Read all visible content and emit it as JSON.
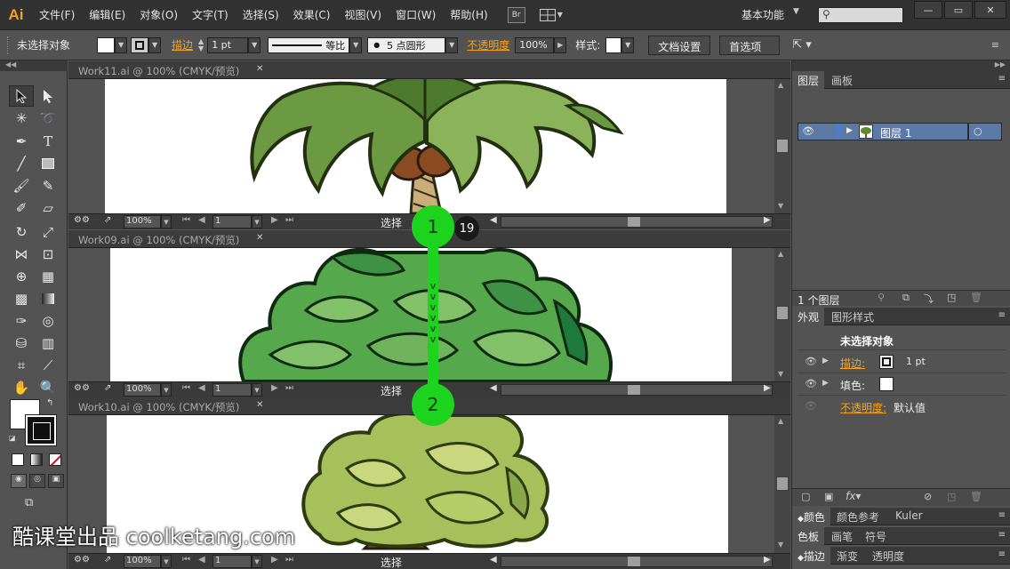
{
  "app": {
    "logo": "Ai"
  },
  "menu": [
    "文件(F)",
    "编辑(E)",
    "对象(O)",
    "文字(T)",
    "选择(S)",
    "效果(C)",
    "视图(V)",
    "窗口(W)",
    "帮助(H)"
  ],
  "menu_extras": {
    "bridge": "Br",
    "workspace": "基本功能"
  },
  "window_buttons": {
    "minimize": "—",
    "restore": "▭",
    "close": "✕"
  },
  "control": {
    "selection": "未选择对象",
    "stroke_label": "描边",
    "stroke_weight": "1 pt",
    "profile": "等比",
    "brush": "5 点圆形",
    "opacity_label": "不透明度",
    "opacity_value": "100%",
    "style_label": "样式:",
    "doc_setup": "文档设置",
    "preferences": "首选项"
  },
  "documents": [
    {
      "title": "Work11.ai @ 100% (CMYK/预览)",
      "zoom": "100%",
      "page": "1",
      "mode": "选择"
    },
    {
      "title": "Work09.ai @ 100% (CMYK/预览)",
      "zoom": "100%",
      "page": "1",
      "mode": "选择"
    },
    {
      "title": "Work10.ai @ 100% (CMYK/预览)",
      "zoom": "100%",
      "page": "1",
      "mode": "选择"
    }
  ],
  "layers_panel": {
    "tabs": [
      "图层",
      "画板"
    ],
    "layer_name": "图层 1",
    "footer": "1 个图层"
  },
  "appearance_panel": {
    "tabs": [
      "外观",
      "图形样式"
    ],
    "heading": "未选择对象",
    "stroke_label": "描边:",
    "stroke_value": "1 pt",
    "fill_label": "填色:",
    "opacity_label": "不透明度:",
    "opacity_value": "默认值"
  },
  "bottom_tabs": {
    "row1": [
      "颜色",
      "颜色参考",
      "Kuler"
    ],
    "row2": [
      "色板",
      "画笔",
      "符号"
    ],
    "row3": [
      "描边",
      "渐变",
      "透明度"
    ]
  },
  "overlay": {
    "marker1": "1",
    "marker2": "2",
    "badge": "19"
  },
  "watermark": "酷课堂出品 coolketang.com",
  "colors": {
    "accent": "#f7a21b",
    "marker_green": "#1ed31e",
    "selection_blue": "#5c7aa6"
  }
}
